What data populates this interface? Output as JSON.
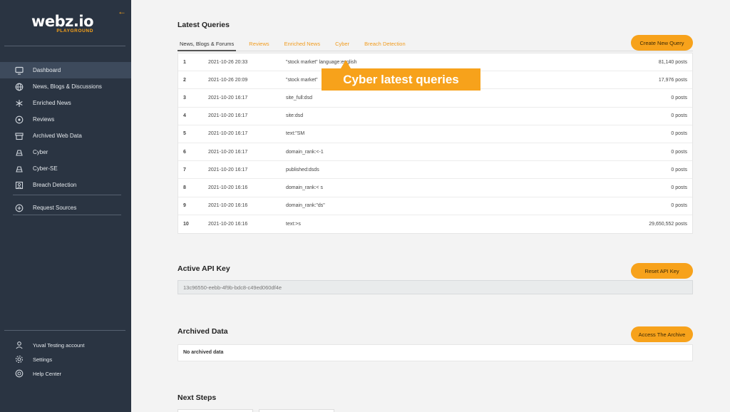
{
  "brand": {
    "name": "webz.io",
    "sub": "PLAYGROUND",
    "accent": "#f7a21b"
  },
  "sidebar": {
    "items": [
      {
        "label": "Dashboard",
        "icon": "monitor-icon"
      },
      {
        "label": "News, Blogs & Discussions",
        "icon": "globe-icon"
      },
      {
        "label": "Enriched News",
        "icon": "sparkle-icon"
      },
      {
        "label": "Reviews",
        "icon": "review-icon"
      },
      {
        "label": "Archived Web Data",
        "icon": "archive-icon"
      },
      {
        "label": "Cyber",
        "icon": "cyber-icon"
      },
      {
        "label": "Cyber-SE",
        "icon": "cyber-se-icon"
      },
      {
        "label": "Breach Detection",
        "icon": "breach-icon"
      }
    ],
    "request_sources": "Request Sources",
    "account": "Yuval Testing account",
    "settings": "Settings",
    "help": "Help Center"
  },
  "latest_queries": {
    "title": "Latest Queries",
    "tabs": [
      "News, Blogs & Forums",
      "Reviews",
      "Enriched News",
      "Cyber",
      "Breach Detection"
    ],
    "create_button": "Create New Query",
    "rows": [
      {
        "num": "1",
        "date": "2021-10-26 20:33",
        "query": "\"stock market\" language:english",
        "count": "81,140 posts"
      },
      {
        "num": "2",
        "date": "2021-10-26 20:09",
        "query": "\"stock market\"",
        "count": "17,976 posts"
      },
      {
        "num": "3",
        "date": "2021-10-20 16:17",
        "query": "site_full:dsd",
        "count": "0 posts"
      },
      {
        "num": "4",
        "date": "2021-10-20 16:17",
        "query": "site:dsd",
        "count": "0 posts"
      },
      {
        "num": "5",
        "date": "2021-10-20 16:17",
        "query": "text:\"SM",
        "count": "0 posts"
      },
      {
        "num": "6",
        "date": "2021-10-20 16:17",
        "query": "domain_rank:<-1",
        "count": "0 posts"
      },
      {
        "num": "7",
        "date": "2021-10-20 16:17",
        "query": "published:dsds",
        "count": "0 posts"
      },
      {
        "num": "8",
        "date": "2021-10-20 16:16",
        "query": "domain_rank:< s",
        "count": "0 posts"
      },
      {
        "num": "9",
        "date": "2021-10-20 16:16",
        "query": "domain_rank:\"ds\"",
        "count": "0 posts"
      },
      {
        "num": "10",
        "date": "2021-10-20 16:16",
        "query": "text:>s",
        "count": "29,650,552 posts"
      }
    ]
  },
  "callout": "Cyber latest queries",
  "api": {
    "title": "Active API Key",
    "reset_button": "Reset API Key",
    "key": "13c96550-eebb-4f9b-bdc8-c49ed060df4e"
  },
  "archived": {
    "title": "Archived Data",
    "button": "Access The Archive",
    "empty": "No archived data"
  },
  "next_steps": {
    "title": "Next Steps"
  }
}
